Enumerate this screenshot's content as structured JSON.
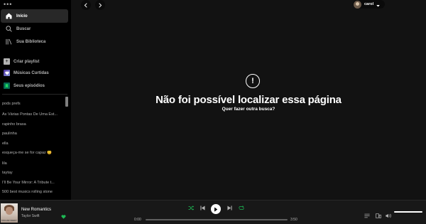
{
  "sidebar": {
    "dots": "•••",
    "nav": [
      {
        "label": "Início",
        "icon": "home-icon"
      },
      {
        "label": "Buscar",
        "icon": "search-icon"
      },
      {
        "label": "Sua Biblioteca",
        "icon": "library-icon"
      }
    ],
    "library": [
      {
        "label": "Criar playlist",
        "icon": "plus-icon",
        "color": "#b3b3b3"
      },
      {
        "label": "Músicas Curtidas",
        "icon": "heart-icon",
        "color": "#4b2ea0"
      },
      {
        "label": "Seus episódios",
        "icon": "bookmark-icon",
        "color": "#056952"
      }
    ],
    "playlists": [
      "pods prefs",
      "As Várias Pontas De Uma Est...",
      "rapinho brasa",
      "paulinha",
      "ella",
      "esqueça-me se for capaz 😊",
      "lila",
      "taytay",
      "I'll Be Your Mirror: A Tribute t...",
      "500 best musics rolling stone"
    ]
  },
  "header": {
    "user_name": "carol"
  },
  "error": {
    "symbol": "!",
    "title": "Não foi possível localizar essa página",
    "subtitle": "Quer fazer outra busca?"
  },
  "player": {
    "track_title": "New Romantics",
    "artist": "Taylor Swift",
    "cover_tag": "TAYLOR SWIFT",
    "time_elapsed": "0:00",
    "time_total": "3:50",
    "progress": 0,
    "volume": 1.0,
    "accent_color": "#1db954"
  }
}
